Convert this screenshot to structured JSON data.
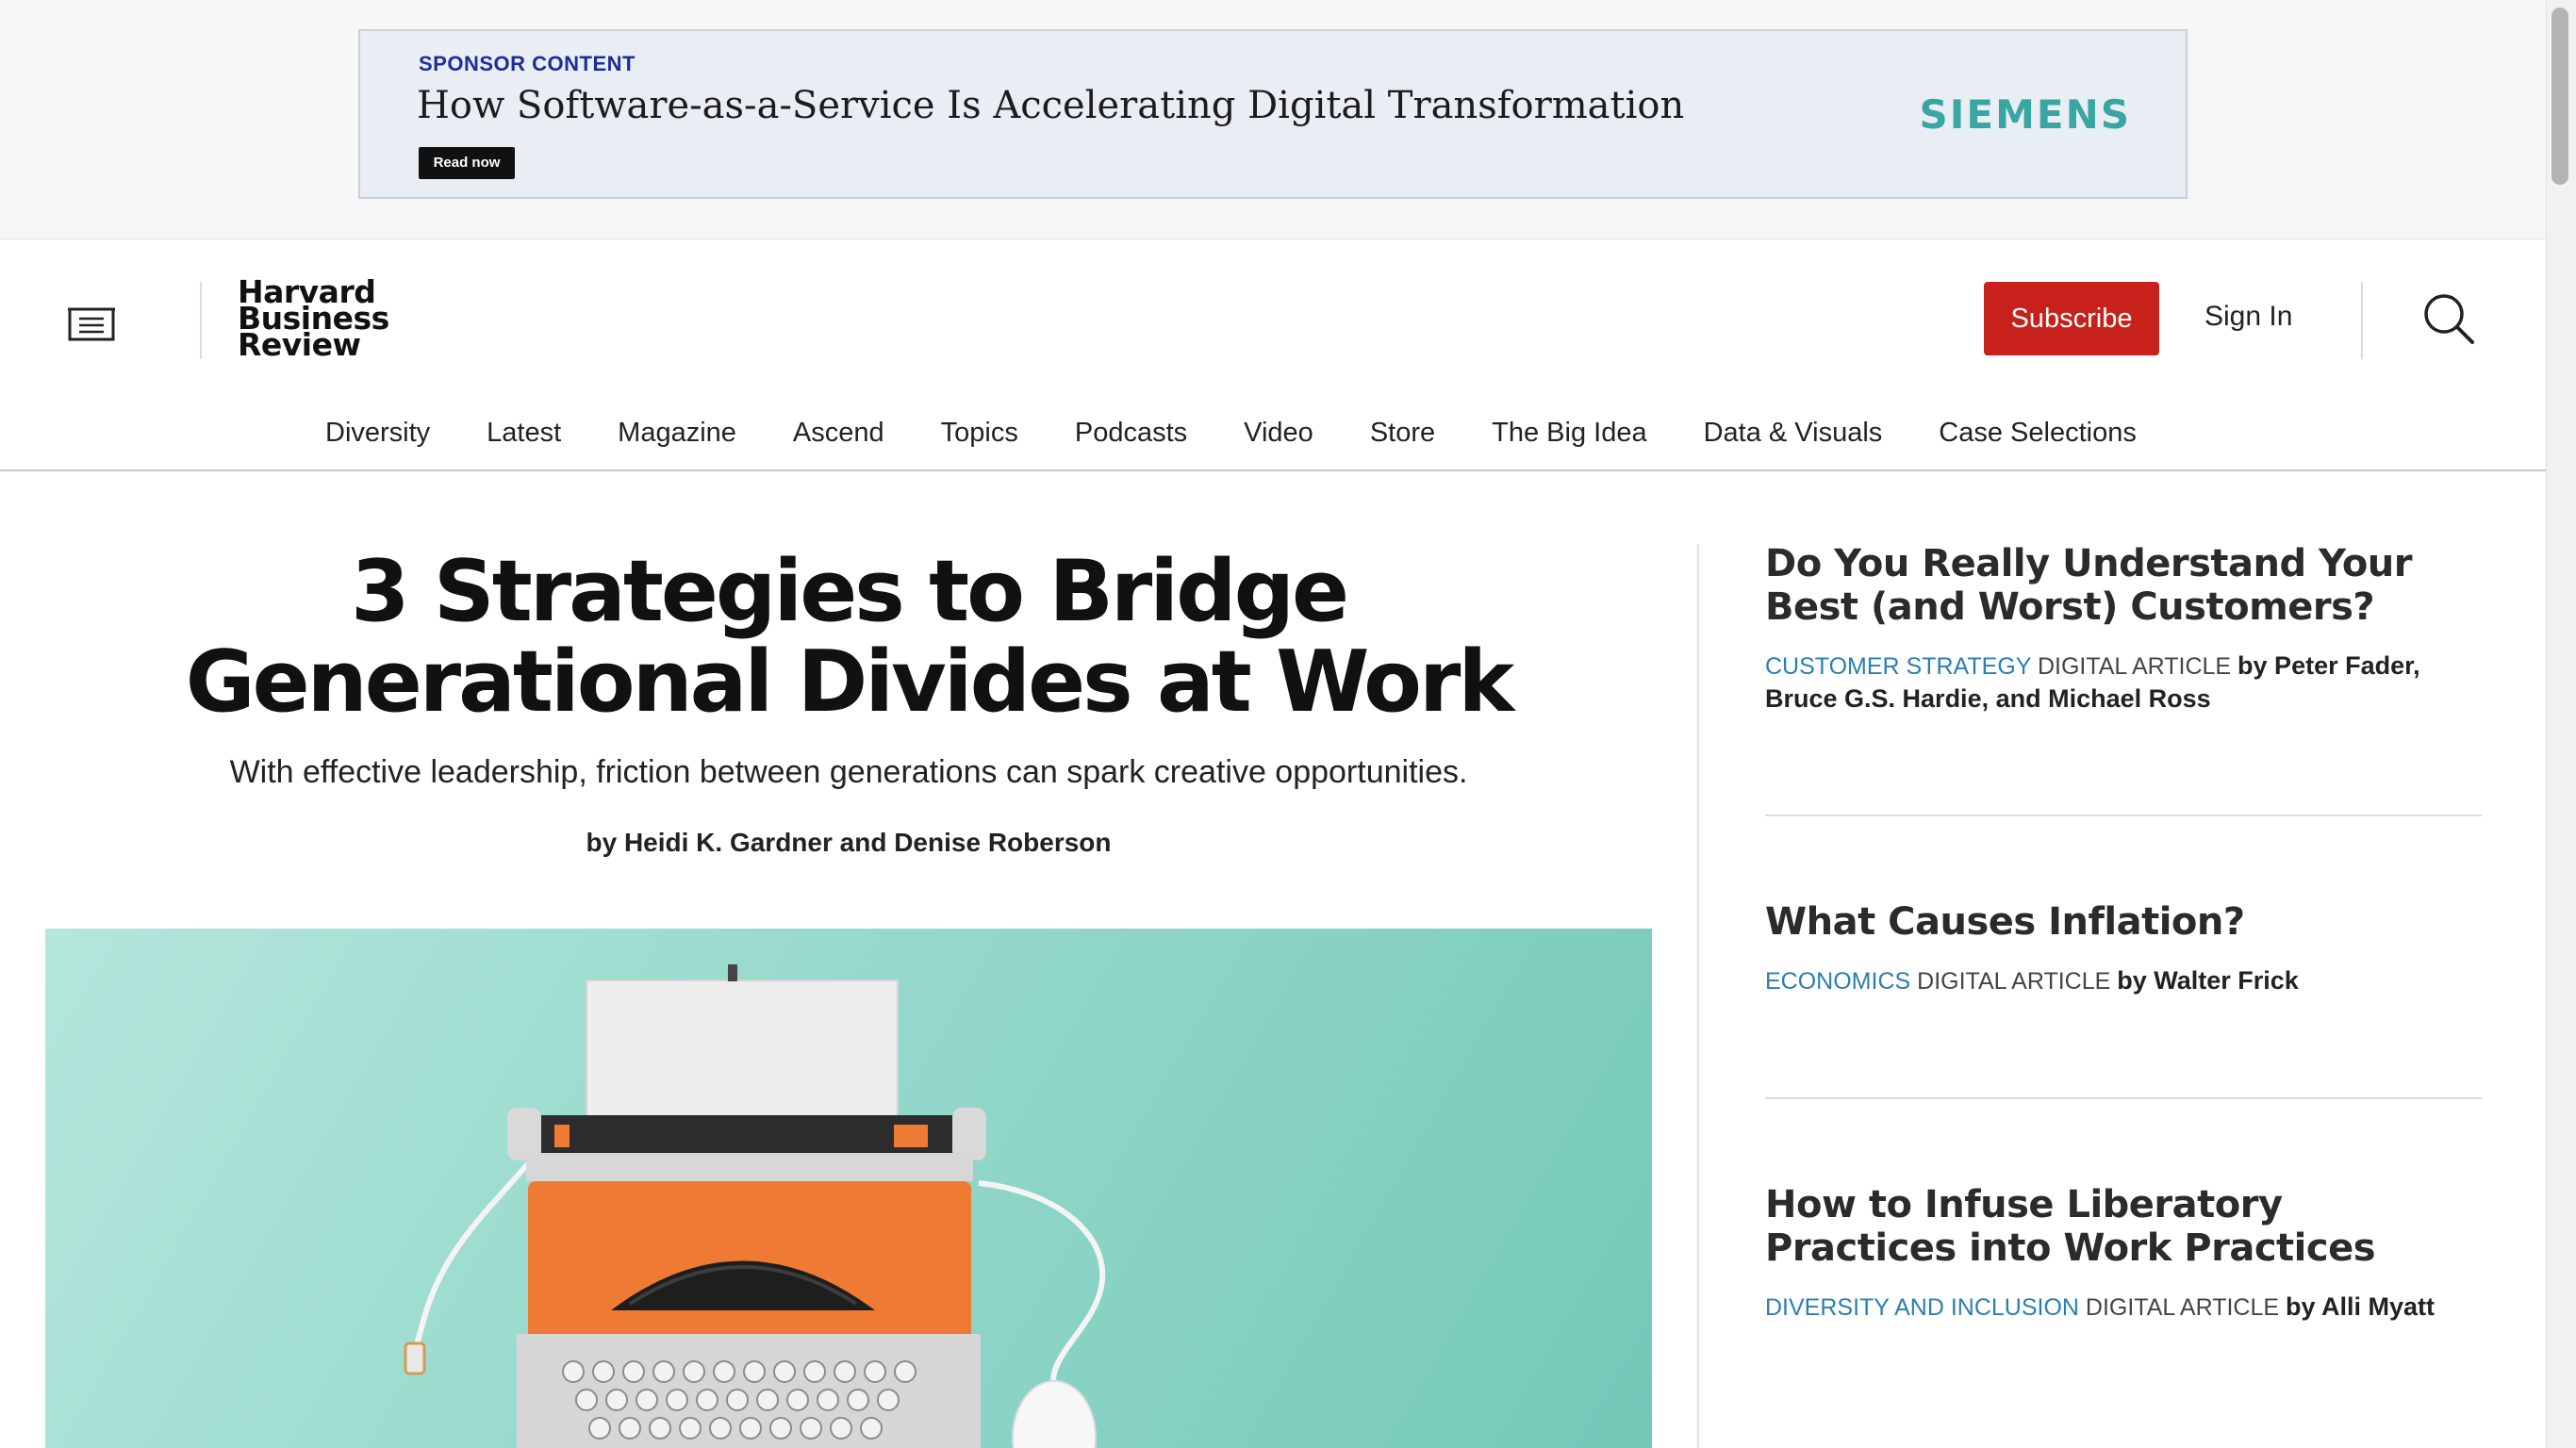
{
  "ad": {
    "label": "SPONSOR CONTENT",
    "headline": "How Software-as-a-Service Is Accelerating Digital Transformation",
    "cta": "Read now",
    "brand": "SIEMENS"
  },
  "header": {
    "logo_line1": "Harvard",
    "logo_line2": "Business",
    "logo_line3": "Review",
    "subscribe": "Subscribe",
    "signin": "Sign In",
    "menu_icon": "menu-icon",
    "search_icon": "search-icon"
  },
  "nav": [
    "Diversity",
    "Latest",
    "Magazine",
    "Ascend",
    "Topics",
    "Podcasts",
    "Video",
    "Store",
    "The Big Idea",
    "Data & Visuals",
    "Case Selections"
  ],
  "article": {
    "title": "3 Strategies to Bridge Generational Divides at Work",
    "dek": "With effective leadership, friction between generations can spark creative opportunities.",
    "byline": "by Heidi K. Gardner and Denise Roberson"
  },
  "rail": [
    {
      "title": "Do You Really Understand Your Best (and Worst) Customers?",
      "topic": "CUSTOMER STRATEGY",
      "type": "DIGITAL ARTICLE",
      "authors": "by Peter Fader, Bruce G.S. Hardie, and Michael Ross"
    },
    {
      "title": "What Causes Inflation?",
      "topic": "ECONOMICS",
      "type": "DIGITAL ARTICLE",
      "authors": "by Walter Frick"
    },
    {
      "title": "How to Infuse Liberatory Practices into Work Practices",
      "topic": "DIVERSITY AND INCLUSION",
      "type": "DIGITAL ARTICLE",
      "authors": "by Alli Myatt"
    }
  ],
  "colors": {
    "subscribe_red": "#c8201a",
    "topic_blue": "#2a7fb2",
    "sponsor_blue": "#1a2e9c",
    "brand_teal": "#3aa6a1",
    "hero_teal": "#96d9cc",
    "typewriter_orange": "#ef7a33"
  }
}
